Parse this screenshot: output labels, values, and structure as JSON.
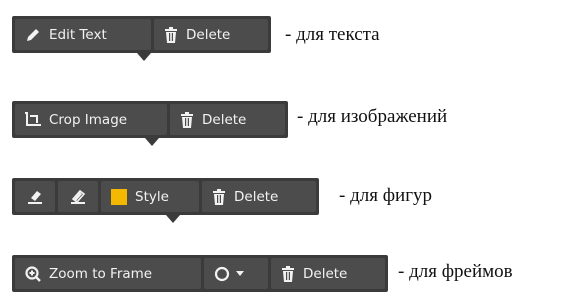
{
  "toolbars": [
    {
      "buttons": {
        "edit_text": "Edit Text",
        "delete": "Delete"
      },
      "description": "- для текста"
    },
    {
      "buttons": {
        "crop_image": "Crop Image",
        "delete": "Delete"
      },
      "description": "- для изображений"
    },
    {
      "buttons": {
        "style": "Style",
        "delete": "Delete"
      },
      "description": "- для фигур"
    },
    {
      "buttons": {
        "zoom_to_frame": "Zoom to Frame",
        "delete": "Delete"
      },
      "description": "- для фреймов"
    }
  ],
  "colors": {
    "toolbar_bg": "#3b3b3b",
    "button_bg": "#4c4c4c",
    "style_swatch": "#f5b800"
  }
}
